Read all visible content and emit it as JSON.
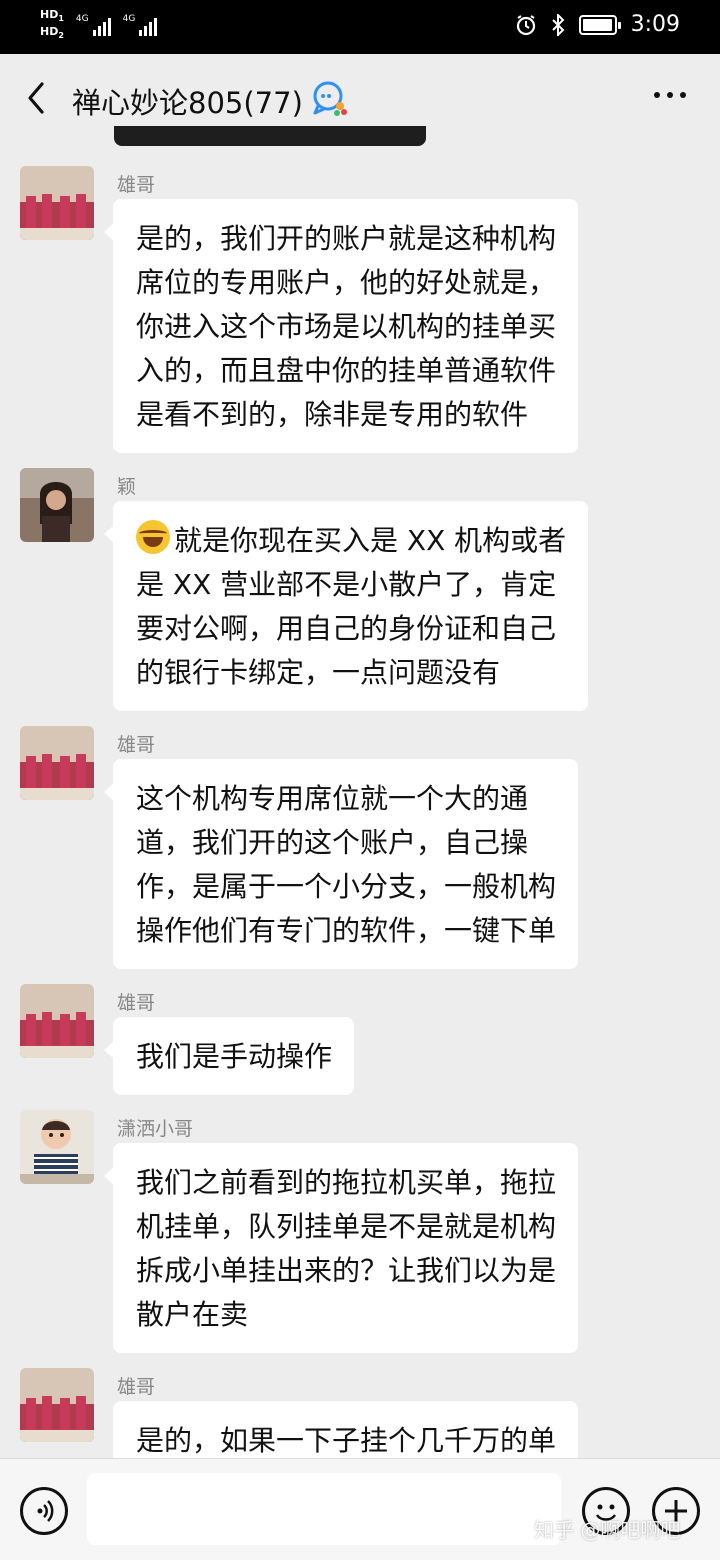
{
  "status_bar": {
    "network_1": "HD",
    "network_2": "HD",
    "signal_1": "4G",
    "signal_2": "4G",
    "time": "3:09",
    "battery_level": 0.92
  },
  "header": {
    "title": "禅心妙论805(77)"
  },
  "messages": [
    {
      "sender": "雄哥",
      "lines": [
        "是的，我们开的账户就是这种机构",
        "席位的专用账户，他的好处就是，",
        "你进入这个市场是以机构的挂单买",
        "入的，而且盘中你的挂单普通软件",
        "是看不到的，除非是专用的软件"
      ]
    },
    {
      "sender": "颖",
      "lines": [
        "就是你现在买入是 XX 机构或者",
        "是 XX 营业部不是小散户了，肯定",
        "要对公啊，用自己的身份证和自己",
        "的银行卡绑定，一点问题没有"
      ]
    },
    {
      "sender": "雄哥",
      "lines": [
        "这个机构专用席位就一个大的通",
        "道，我们开的这个账户，自己操",
        "作，是属于一个小分支，一般机构",
        "操作他们有专门的软件，一键下单"
      ]
    },
    {
      "sender": "雄哥",
      "lines": [
        "我们是手动操作"
      ]
    },
    {
      "sender": "潇洒小哥",
      "lines": [
        "我们之前看到的拖拉机买单，拖拉",
        "机挂单，队列挂单是不是就是机构",
        "拆成小单挂出来的？让我们以为是",
        "散户在卖"
      ]
    },
    {
      "sender": "雄哥",
      "lines": [
        "是的，如果一下子挂个几千万的单"
      ]
    }
  ],
  "watermark": "知乎 @啊吧啊吧"
}
